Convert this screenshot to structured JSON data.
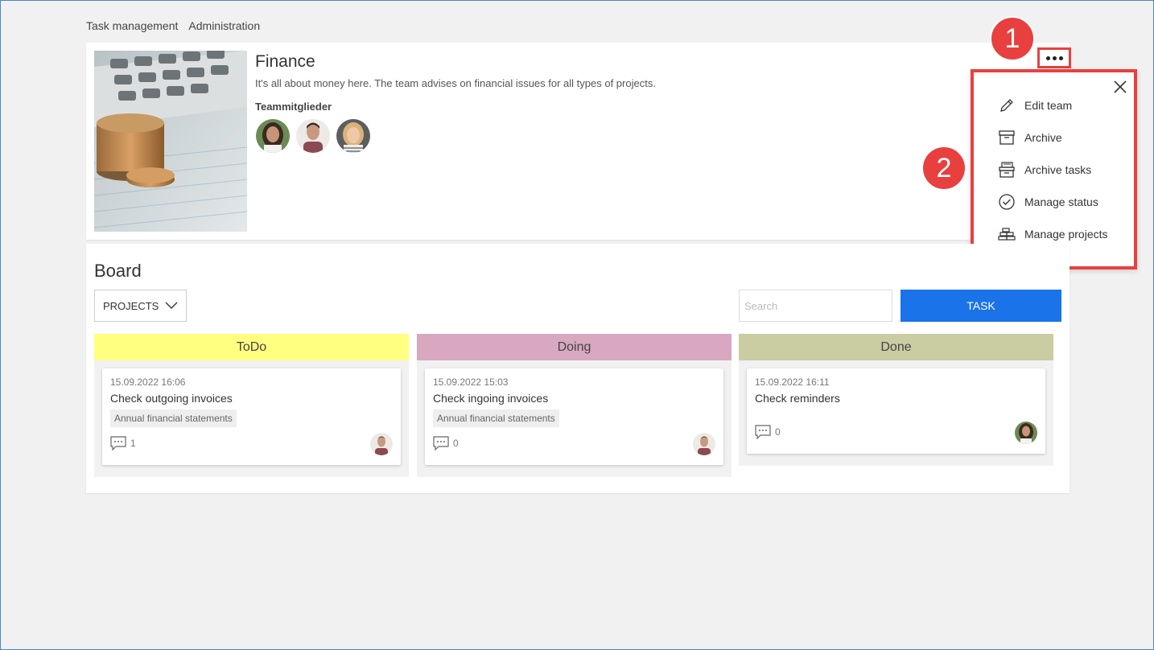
{
  "nav": {
    "items": [
      "Task management",
      "Administration"
    ]
  },
  "team": {
    "title": "Finance",
    "description": "It's all about money here. The team advises on financial issues for all types of projects.",
    "members_label": "Teammitglieder",
    "member_count": 3
  },
  "callouts": [
    "1",
    "2"
  ],
  "menu": {
    "items": [
      {
        "label": "Edit team",
        "icon": "pencil-icon"
      },
      {
        "label": "Archive",
        "icon": "archive-box-icon"
      },
      {
        "label": "Archive tasks",
        "icon": "archive-tasks-icon"
      },
      {
        "label": "Manage status",
        "icon": "check-circle-icon"
      },
      {
        "label": "Manage projects",
        "icon": "projects-stack-icon"
      }
    ]
  },
  "board": {
    "title": "Board",
    "projects_label": "PROJECTS",
    "search_placeholder": "Search",
    "task_button": "TASK",
    "columns": [
      {
        "name": "ToDo",
        "color": "#ffff80",
        "cards": [
          {
            "date": "15.09.2022 16:06",
            "title": "Check outgoing invoices",
            "tag": "Annual financial statements",
            "comments": "1"
          }
        ]
      },
      {
        "name": "Doing",
        "color": "#d7a8c0",
        "cards": [
          {
            "date": "15.09.2022 15:03",
            "title": "Check ingoing invoices",
            "tag": "Annual financial statements",
            "comments": "0"
          }
        ]
      },
      {
        "name": "Done",
        "color": "#cacca2",
        "cards": [
          {
            "date": "15.09.2022 16:11",
            "title": "Check reminders",
            "tag": "",
            "comments": "0"
          }
        ]
      }
    ]
  },
  "colors": {
    "accent": "#1a73e8",
    "callout": "#e8403f"
  }
}
